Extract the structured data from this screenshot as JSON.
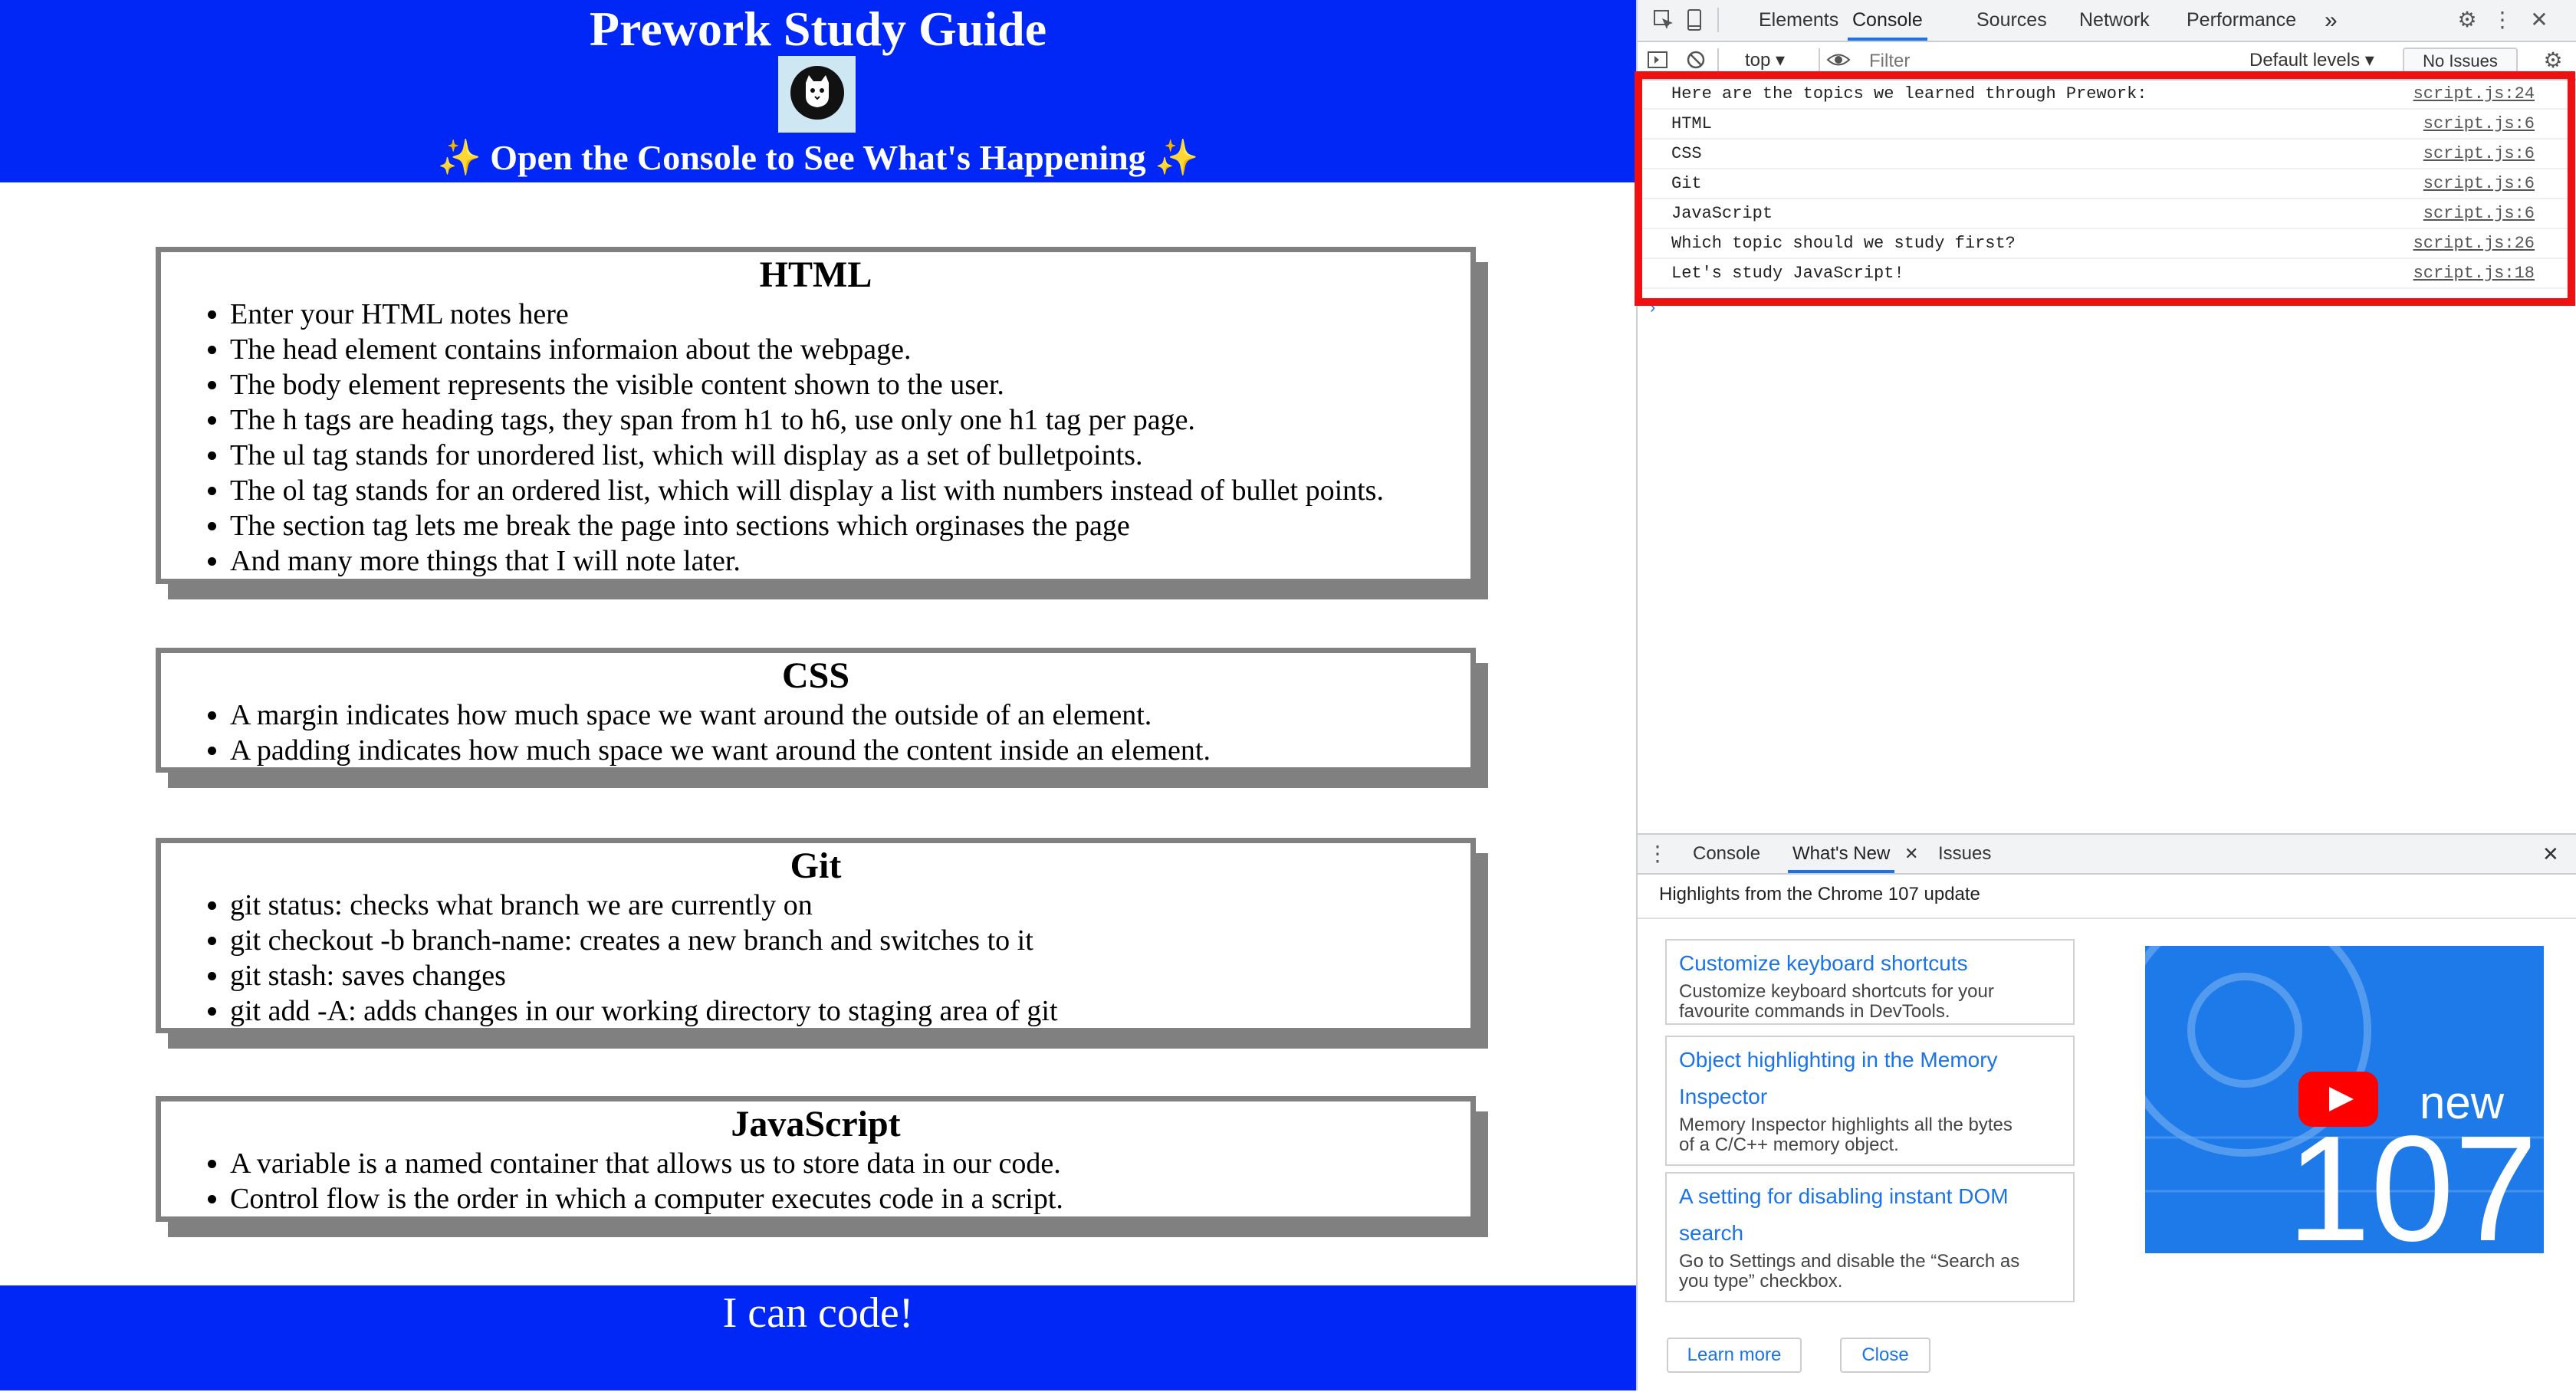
{
  "page": {
    "title": "Prework Study Guide",
    "subtitle": "✨ Open the Console to See What's Happening ✨",
    "sections": [
      {
        "heading": "HTML",
        "items": [
          "Enter your HTML notes here",
          "The head element contains informaion about the webpage.",
          "The body element represents the visible content shown to the user.",
          "The h tags are heading tags, they span from h1 to h6, use only one h1 tag per page.",
          "The ul tag stands for unordered list, which will display as a set of bulletpoints.",
          "The ol tag stands for an ordered list, which will display a list with numbers instead of bullet points.",
          "The section tag lets me break the page into sections which orginases the page",
          "And many more things that I will note later."
        ]
      },
      {
        "heading": "CSS",
        "items": [
          "A margin indicates how much space we want around the outside of an element.",
          "A padding indicates how much space we want around the content inside an element."
        ]
      },
      {
        "heading": "Git",
        "items": [
          "git status: checks what branch we are currently on",
          "git checkout -b branch-name: creates a new branch and switches to it",
          "git stash: saves changes",
          "git add -A: adds changes in our working directory to staging area of git"
        ]
      },
      {
        "heading": "JavaScript",
        "items": [
          "A variable is a named container that allows us to store data in our code.",
          "Control flow is the order in which a computer executes code in a script."
        ]
      }
    ],
    "footer": "I can code!"
  },
  "devtools": {
    "tabs": [
      "Elements",
      "Console",
      "Sources",
      "Network",
      "Performance"
    ],
    "active_tab": "Console",
    "more_tabs": "»",
    "console_toolbar": {
      "context": "top ▾",
      "filter_placeholder": "Filter",
      "levels": "Default levels ▾",
      "issues": "No Issues"
    },
    "console_log": [
      {
        "message": "Here are the topics we learned through Prework:",
        "source": "script.js:24"
      },
      {
        "message": "HTML",
        "source": "script.js:6"
      },
      {
        "message": "CSS",
        "source": "script.js:6"
      },
      {
        "message": "Git",
        "source": "script.js:6"
      },
      {
        "message": "JavaScript",
        "source": "script.js:6"
      },
      {
        "message": "Which topic should we study first?",
        "source": "script.js:26"
      },
      {
        "message": "Let's study JavaScript!",
        "source": "script.js:18"
      }
    ],
    "prompt": "›",
    "drawer": {
      "tabs": [
        "Console",
        "What's New",
        "Issues"
      ],
      "active_tab": "What's New",
      "highlights": "Highlights from the Chrome 107 update",
      "cards": [
        {
          "title_lines": [
            "Customize keyboard shortcuts"
          ],
          "desc_lines": [
            "Customize keyboard shortcuts for your",
            "favourite commands in DevTools."
          ]
        },
        {
          "title_lines": [
            "Object highlighting in the Memory",
            "Inspector"
          ],
          "desc_lines": [
            "Memory Inspector highlights all the bytes",
            "of a C/C++ memory object."
          ]
        },
        {
          "title_lines": [
            "A setting for disabling instant DOM",
            "search"
          ],
          "desc_lines": [
            "Go to Settings and disable the “Search as",
            "you type” checkbox."
          ]
        }
      ],
      "promo": {
        "label": "new",
        "version": "107"
      },
      "learn_more": "Learn more",
      "close": "Close"
    }
  },
  "colors": {
    "page_blue": "#0027f5",
    "card_border": "#808080",
    "highlight_red": "#f01010",
    "devtools_blue": "#1a73e8"
  }
}
